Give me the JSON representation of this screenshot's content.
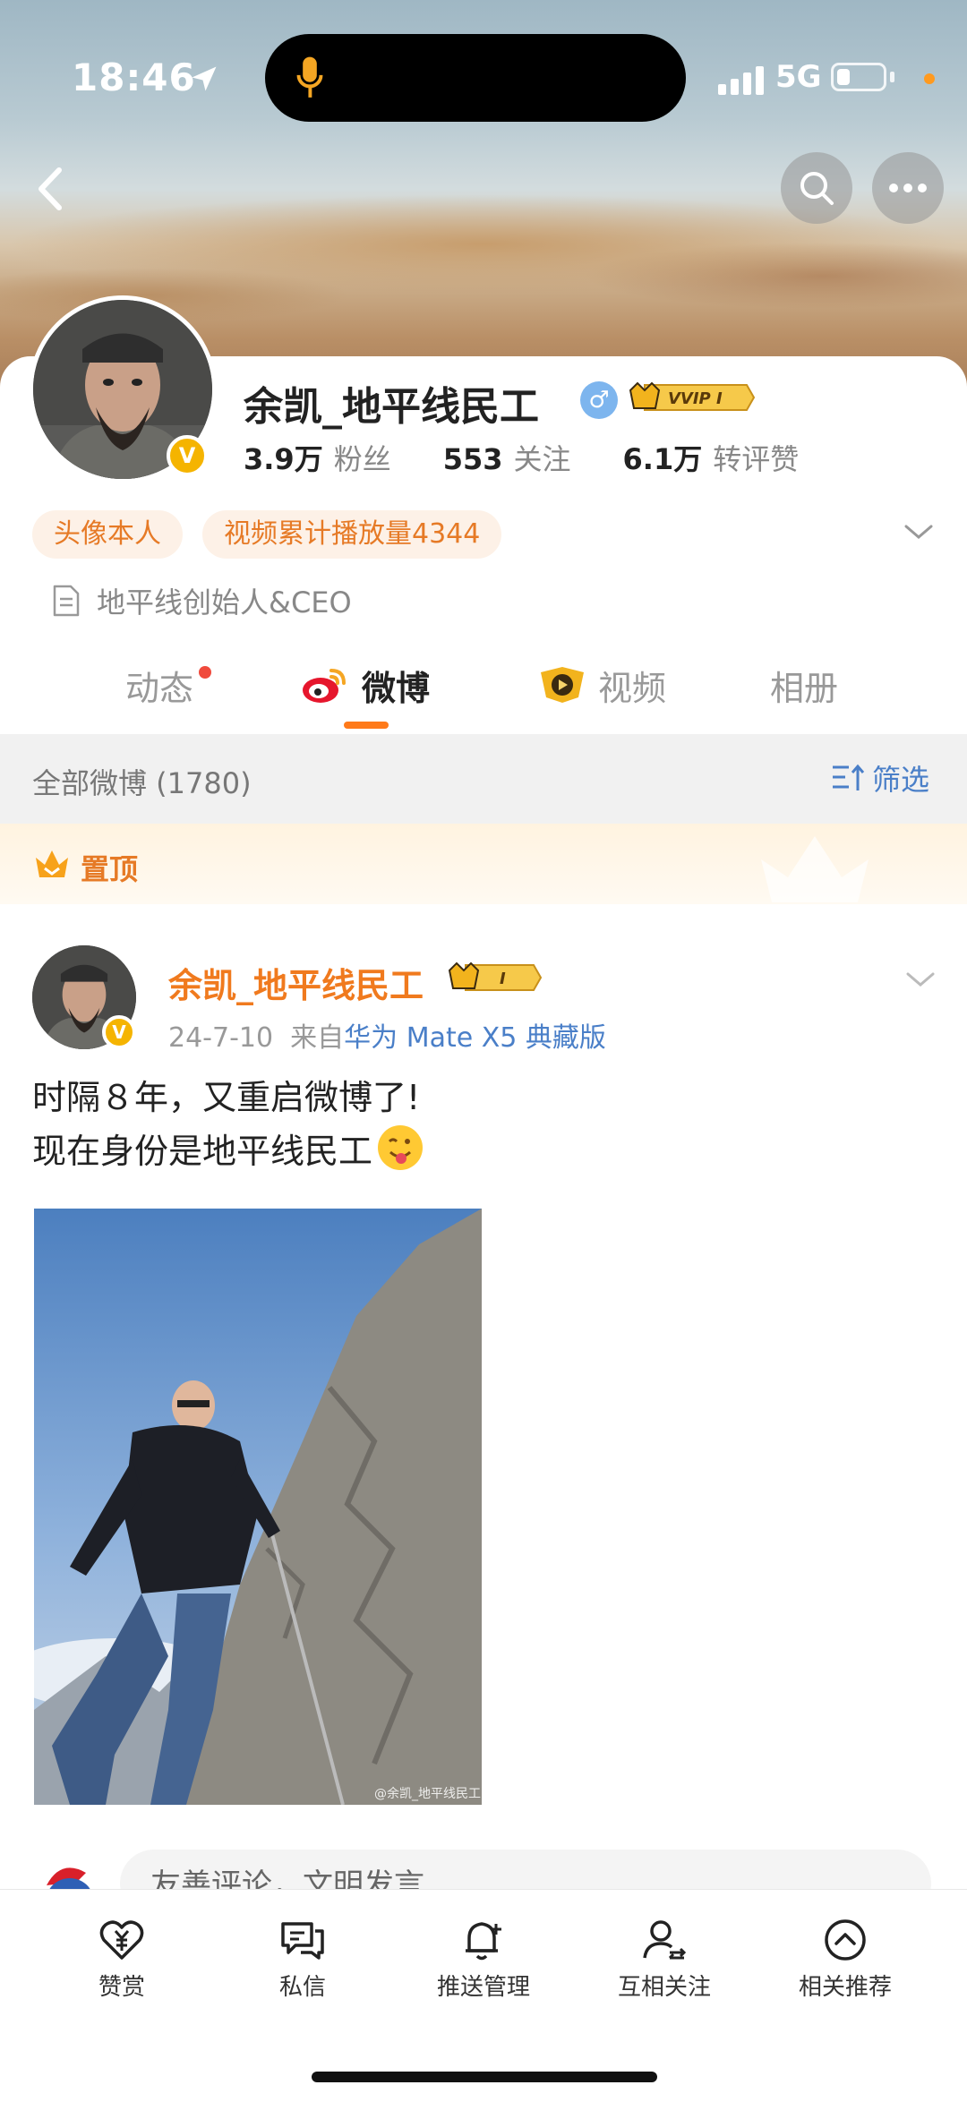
{
  "status_bar": {
    "time": "18:46",
    "network": "5G"
  },
  "profile": {
    "username": "余凯_地平线民工",
    "gender_symbol": "♂",
    "vip_label": "VVIP I",
    "stats": [
      {
        "value": "3.9万",
        "label": "粉丝"
      },
      {
        "value": "553",
        "label": "关注"
      },
      {
        "value": "6.1万",
        "label": "转评赞"
      }
    ],
    "chips": [
      "头像本人",
      "视频累计播放量4344"
    ],
    "bio": "地平线创始人&CEO"
  },
  "tabs": [
    {
      "label": "动态",
      "has_dot": true
    },
    {
      "label": "微博",
      "active": true
    },
    {
      "label": "视频"
    },
    {
      "label": "相册"
    }
  ],
  "filter": {
    "count_label": "全部微博 (1780)",
    "button_label": "筛选"
  },
  "pinned": {
    "label": "置顶"
  },
  "post": {
    "author": "余凯_地平线民工",
    "author_badge": "I",
    "date": "24-7-10",
    "source_prefix": "来自",
    "source": "华为 Mate X5 典藏版",
    "text_line1": "时隔８年，又重启微博了!",
    "text_line2": "现在身份是地平线民工",
    "watermark": "@余凯_地平线民工"
  },
  "comment": {
    "placeholder": "友善评论，文明发言"
  },
  "bottom_bar": [
    {
      "label": "赞赏",
      "icon": "reward-icon"
    },
    {
      "label": "私信",
      "icon": "message-icon"
    },
    {
      "label": "推送管理",
      "icon": "bell-icon"
    },
    {
      "label": "互相关注",
      "icon": "follow-icon"
    },
    {
      "label": "相关推荐",
      "icon": "recommend-icon"
    }
  ],
  "colors": {
    "accent_orange": "#ff7a1a",
    "link_blue": "#4a7fc8",
    "vip_gold": "#f5b400"
  }
}
